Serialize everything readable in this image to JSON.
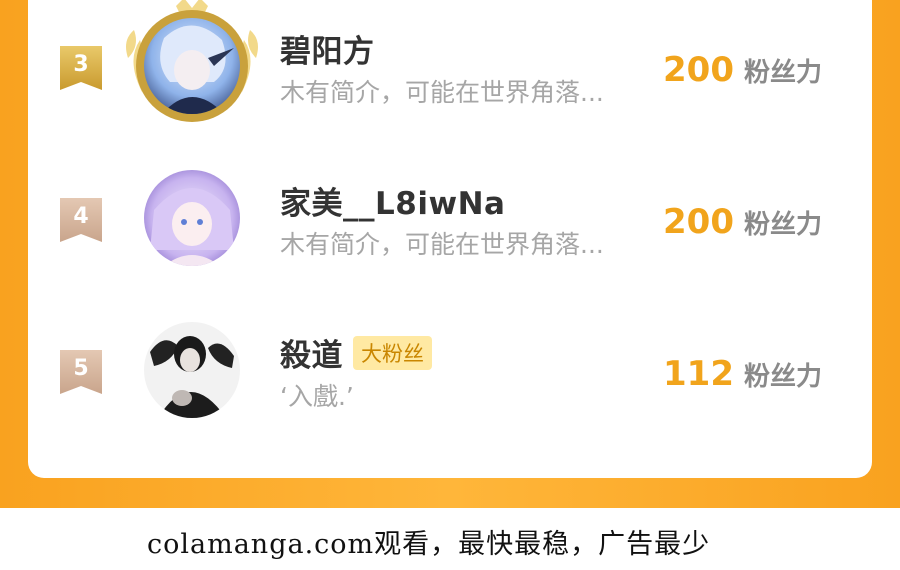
{
  "ranking": {
    "rows": [
      {
        "rank": "3",
        "name": "碧阳方",
        "tag": "",
        "bio": "木有简介，可能在世界角落...",
        "power": "200",
        "unit": "粉丝力"
      },
      {
        "rank": "4",
        "name": "家美__L8iwNa",
        "tag": "",
        "bio": "木有简介，可能在世界角落...",
        "power": "200",
        "unit": "粉丝力"
      },
      {
        "rank": "5",
        "name": "殺道",
        "tag": "大粉丝",
        "bio": "‘入戲.’",
        "power": "112",
        "unit": "粉丝力"
      }
    ]
  },
  "footer": {
    "text": "colamanga.com观看，最快最稳，广告最少"
  },
  "colors": {
    "accent": "#f9a21f",
    "rank3_badge": "#d8b24a",
    "rank_other_badge": "#d7b6a0",
    "power": "#f1a41c"
  },
  "icons": {
    "rank3_wreath": "laurel-wreath-icon"
  }
}
